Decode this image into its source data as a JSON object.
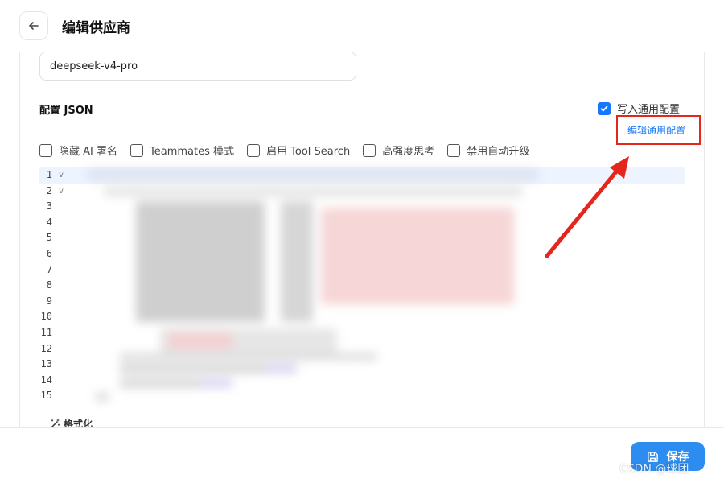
{
  "header": {
    "title": "编辑供应商",
    "back_icon": "arrow-left-icon"
  },
  "form": {
    "model_value": "deepseek-v4-pro",
    "json_label": "配置 JSON",
    "write_common_label": "写入通用配置",
    "write_common_checked": true,
    "edit_common_link": "编辑通用配置",
    "options": [
      {
        "label": "隐藏 AI 署名",
        "checked": false
      },
      {
        "label": "Teammates 模式",
        "checked": false
      },
      {
        "label": "启用 Tool Search",
        "checked": false
      },
      {
        "label": "高强度思考",
        "checked": false
      },
      {
        "label": "禁用自动升级",
        "checked": false
      }
    ]
  },
  "editor": {
    "line_numbers": [
      "1",
      "2",
      "3",
      "4",
      "5",
      "6",
      "7",
      "8",
      "9",
      "10",
      "11",
      "12",
      "13",
      "14",
      "15"
    ],
    "fold_markers": [
      "v",
      "v"
    ]
  },
  "format_button": {
    "label": "格式化",
    "icon": "magic-wand-icon"
  },
  "footer": {
    "save_label": "保存",
    "save_icon": "floppy-disk-icon",
    "watermark": "CSDN @球团"
  },
  "colors": {
    "accent": "#1677ff",
    "save_button": "#2d8cf0",
    "highlight_box": "#e5261c"
  }
}
